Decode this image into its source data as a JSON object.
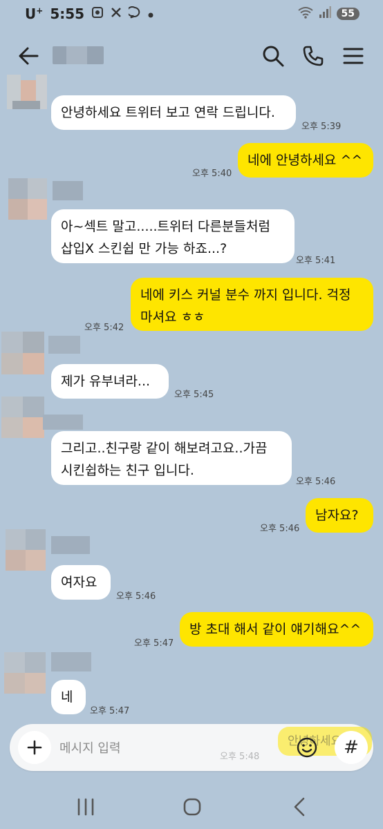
{
  "status_bar": {
    "carrier": "U",
    "carrier_sup": "+",
    "time": "5:55",
    "battery": "55"
  },
  "header": {
    "title": "",
    "icons": [
      "back-arrow-icon",
      "search-icon",
      "phone-icon",
      "menu-icon"
    ]
  },
  "messages": [
    {
      "dir": "in",
      "text": "안녕하세요 트위터 보고 연락 드립니다.",
      "time": "오후 5:39"
    },
    {
      "dir": "out",
      "text": "네에 안녕하세요 ^^",
      "time": "오후 5:40"
    },
    {
      "dir": "in",
      "text": "아~섹트 말고.....트위터 다른분들처럼\n삽입X 스킨쉽 만 가능 하죠...?",
      "time": "오후 5:41"
    },
    {
      "dir": "out",
      "text": "네에 키스 커널 분수 까지 입니다. 걱정\n마셔요 ㅎㅎ",
      "time": "오후 5:42"
    },
    {
      "dir": "in",
      "text": "제가 유부녀라...",
      "time": "오후 5:45"
    },
    {
      "dir": "in",
      "text": "그리고..친구랑 같이 해보려고요..가끔\n시킨쉽하는 친구 입니다.",
      "time": "오후 5:46"
    },
    {
      "dir": "out",
      "text": "남자요?",
      "time": "오후 5:46"
    },
    {
      "dir": "in",
      "text": "여자요",
      "time": "오후 5:46"
    },
    {
      "dir": "out",
      "text": "방 초대 해서 같이 얘기해요^^",
      "time": "오후 5:47"
    },
    {
      "dir": "in",
      "text": "네",
      "time": "오후 5:47"
    }
  ],
  "input": {
    "placeholder": "메시지 입력",
    "ghost_text": "안녕하세요",
    "ghost_time": "오후 5:48",
    "hash_label": "#"
  },
  "colors": {
    "background": "#b3c6d8",
    "bubble_out": "#fee500",
    "bubble_in": "#ffffff"
  }
}
